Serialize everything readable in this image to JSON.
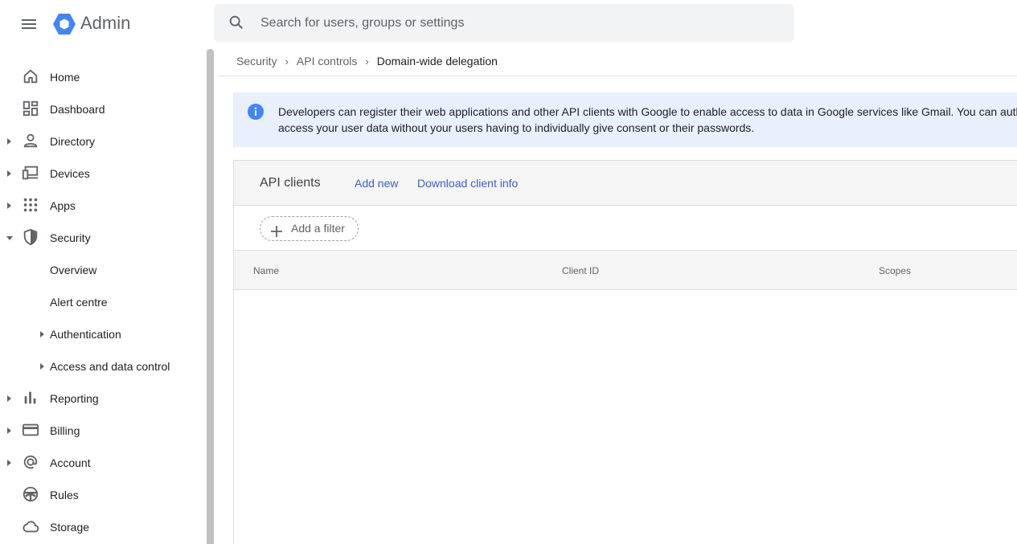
{
  "header": {
    "brand": "Admin",
    "menu_icon": "hamburger-menu-icon",
    "logo_icon": "google-admin-logo-icon",
    "search_placeholder": "Search for users, groups or settings"
  },
  "sidebar": {
    "items": [
      {
        "label": "Home",
        "icon": "home-icon"
      },
      {
        "label": "Dashboard",
        "icon": "dashboard-icon"
      },
      {
        "label": "Directory",
        "icon": "person-icon"
      },
      {
        "label": "Devices",
        "icon": "devices-icon"
      },
      {
        "label": "Apps",
        "icon": "apps-grid-icon"
      },
      {
        "label": "Security",
        "icon": "shield-icon"
      },
      {
        "label": "Overview"
      },
      {
        "label": "Alert centre"
      },
      {
        "label": "Authentication"
      },
      {
        "label": "Access and data control"
      },
      {
        "label": "Reporting",
        "icon": "bar-chart-icon"
      },
      {
        "label": "Billing",
        "icon": "credit-card-icon"
      },
      {
        "label": "Account",
        "icon": "at-sign-icon"
      },
      {
        "label": "Rules",
        "icon": "steering-wheel-icon"
      },
      {
        "label": "Storage",
        "icon": "cloud-icon"
      }
    ]
  },
  "breadcrumb": {
    "items": [
      "Security",
      "API controls"
    ],
    "current": "Domain-wide delegation"
  },
  "banner": {
    "line1": "Developers can register their web applications and other API clients with Google to enable access to data in Google services like Gmail. You can auth",
    "line2": "access your user data without your users having to individually give consent or their passwords."
  },
  "card": {
    "title": "API clients",
    "add_new": "Add new",
    "download": "Download client info",
    "filter_label": "Add a filter",
    "columns": [
      "Name",
      "Client ID",
      "Scopes"
    ]
  },
  "colors": {
    "accent_link": "#3c5fc7",
    "banner_bg": "#e8f0fe",
    "info_blue": "#4285f4"
  }
}
